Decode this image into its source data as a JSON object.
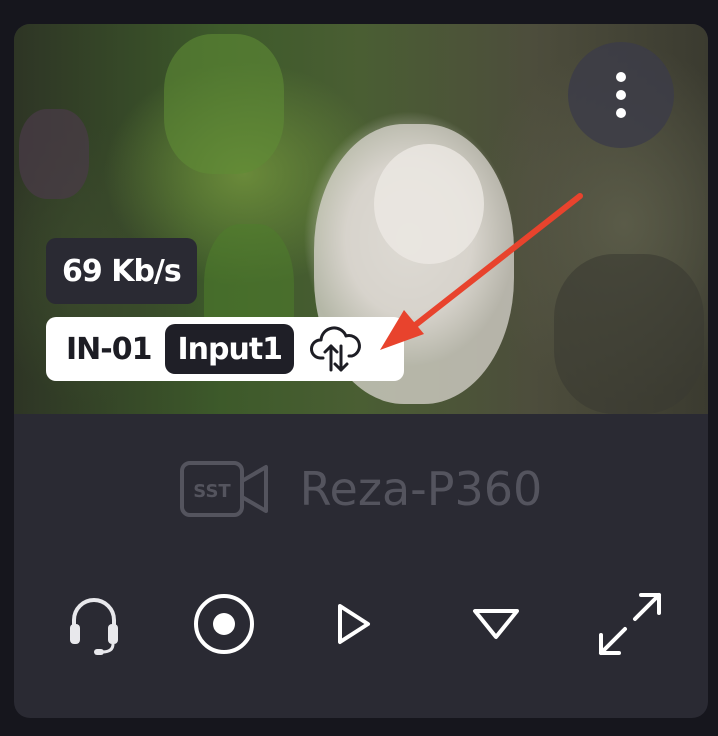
{
  "stream": {
    "bitrate": "69 Kb/s",
    "input_id": "IN-01",
    "input_name": "Input1"
  },
  "device": {
    "badge_text": "SST",
    "name": "Reza-P360"
  },
  "icons": {
    "menu": "more-vertical-icon",
    "cloud": "cloud-upload-download-icon",
    "device": "camera-icon",
    "headset": "headset-icon",
    "record": "record-icon",
    "play": "play-icon",
    "expand-down": "triangle-down-icon",
    "fullscreen": "fullscreen-icon"
  },
  "colors": {
    "card": "#2a2a33",
    "annotation_arrow": "#e8432d",
    "muted_text": "#54545e",
    "control_icon": "#ffffff"
  }
}
